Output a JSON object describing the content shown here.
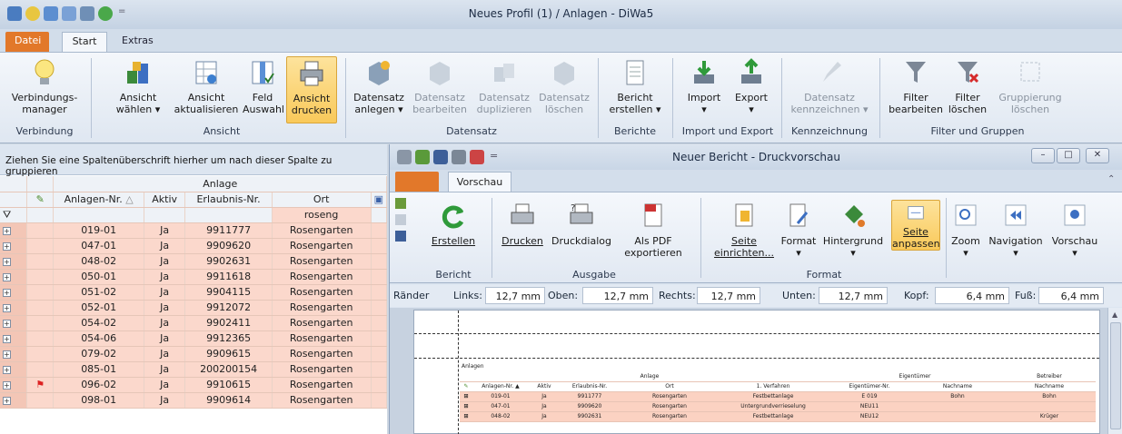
{
  "window": {
    "title": "Neues Profil (1) / Anlagen - DiWa5"
  },
  "tabs": {
    "datei": "Datei",
    "start": "Start",
    "extras": "Extras"
  },
  "ribbon": {
    "buttons": {
      "verbindungsmanager": [
        "Verbindungs-",
        "manager"
      ],
      "ansicht_waehlen": [
        "Ansicht",
        "wählen ▾"
      ],
      "ansicht_aktualisieren": [
        "Ansicht",
        "aktualisieren"
      ],
      "feld_auswahl": [
        "Feld",
        "Auswahl"
      ],
      "ansicht_drucken": [
        "Ansicht",
        "drucken"
      ],
      "datensatz_anlegen": [
        "Datensatz",
        "anlegen ▾"
      ],
      "datensatz_bearbeiten": [
        "Datensatz",
        "bearbeiten"
      ],
      "datensatz_duplizieren": [
        "Datensatz",
        "duplizieren"
      ],
      "datensatz_loeschen": [
        "Datensatz",
        "löschen"
      ],
      "bericht_erstellen": [
        "Bericht",
        "erstellen ▾"
      ],
      "import": [
        "Import",
        "▾"
      ],
      "export": [
        "Export",
        "▾"
      ],
      "datensatz_kennzeichnen": [
        "Datensatz",
        "kennzeichnen ▾"
      ],
      "filter_bearbeiten": [
        "Filter",
        "bearbeiten"
      ],
      "filter_loeschen": [
        "Filter",
        "löschen"
      ],
      "gruppierung_loeschen": [
        "Gruppierung",
        "löschen"
      ]
    },
    "groups": {
      "verbindung": "Verbindung",
      "ansicht": "Ansicht",
      "datensatz": "Datensatz",
      "berichte": "Berichte",
      "import_export": "Import und Export",
      "kennzeichnung": "Kennzeichnung",
      "filter_gruppen": "Filter und Gruppen"
    }
  },
  "grid": {
    "group_hint": "Ziehen Sie eine Spaltenüberschrift hierher um nach dieser Spalte zu gruppieren",
    "band": "Anlage",
    "columns": [
      "Anlagen-Nr.",
      "Aktiv",
      "Erlaubnis-Nr.",
      "Ort"
    ],
    "sort_indicator": "△",
    "filter_value": "roseng",
    "rows": [
      [
        "019-01",
        "Ja",
        "9911777",
        "Rosengarten"
      ],
      [
        "047-01",
        "Ja",
        "9909620",
        "Rosengarten"
      ],
      [
        "048-02",
        "Ja",
        "9902631",
        "Rosengarten"
      ],
      [
        "050-01",
        "Ja",
        "9911618",
        "Rosengarten"
      ],
      [
        "051-02",
        "Ja",
        "9904115",
        "Rosengarten"
      ],
      [
        "052-01",
        "Ja",
        "9912072",
        "Rosengarten"
      ],
      [
        "054-02",
        "Ja",
        "9902411",
        "Rosengarten"
      ],
      [
        "054-06",
        "Ja",
        "9912365",
        "Rosengarten"
      ],
      [
        "079-02",
        "Ja",
        "9909615",
        "Rosengarten"
      ],
      [
        "085-01",
        "Ja",
        "200200154",
        "Rosengarten"
      ],
      [
        "096-02",
        "Ja",
        "9910615",
        "Rosengarten"
      ],
      [
        "098-01",
        "Ja",
        "9909614",
        "Rosengarten"
      ]
    ]
  },
  "report": {
    "title": "Neuer Bericht - Druckvorschau",
    "tab": "Vorschau",
    "buttons": {
      "erstellen": "Erstellen",
      "drucken": "Drucken",
      "druckdialog": "Druckdialog",
      "als_pdf": [
        "Als PDF",
        "exportieren"
      ],
      "seite_einrichten": [
        "Seite",
        "einrichten..."
      ],
      "format": [
        "Format",
        "▾"
      ],
      "hintergrund": [
        "Hintergrund",
        "▾"
      ],
      "seite_anpassen": [
        "Seite",
        "anpassen"
      ],
      "zoom": [
        "Zoom",
        "▾"
      ],
      "navigation": [
        "Navigation",
        "▾"
      ],
      "vorschau": [
        "Vorschau",
        "▾"
      ]
    },
    "groups": {
      "bericht": "Bericht",
      "ausgabe": "Ausgabe",
      "format": "Format"
    },
    "margins": {
      "raender": "Ränder",
      "links_label": "Links:",
      "links": "12,7 mm",
      "oben_label": "Oben:",
      "oben": "12,7 mm",
      "rechts_label": "Rechts:",
      "rechts": "12,7 mm",
      "unten_label": "Unten:",
      "unten": "12,7 mm",
      "kopf_label": "Kopf:",
      "kopf": "6,4 mm",
      "fuss_label": "Fuß:",
      "fuss": "6,4 mm"
    },
    "preview": {
      "section": "Anlagen",
      "band_anlage": "Anlage",
      "band_eigentuemer": "Eigentümer",
      "band_betreiber": "Betreiber",
      "columns": [
        "Anlagen-Nr.",
        "Aktiv",
        "Erlaubnis-Nr.",
        "Ort",
        "1. Verfahren",
        "Eigentümer-Nr.",
        "Nachname",
        "Nachname"
      ],
      "sort_indicator": "▲",
      "rows": [
        [
          "019-01",
          "Ja",
          "9911777",
          "Rosengarten",
          "Festbettanlage",
          "E 019",
          "Bohn",
          "Bohn"
        ],
        [
          "047-01",
          "Ja",
          "9909620",
          "Rosengarten",
          "Untergrundverrieselung",
          "NEU11",
          "",
          ""
        ],
        [
          "048-02",
          "Ja",
          "9902631",
          "Rosengarten",
          "Festbettanlage",
          "NEU12",
          "",
          "Krüger"
        ]
      ]
    }
  },
  "colors": {
    "accent": "#e2782a",
    "row_highlight": "#fbd8cc",
    "selected": "#f9c95a"
  }
}
